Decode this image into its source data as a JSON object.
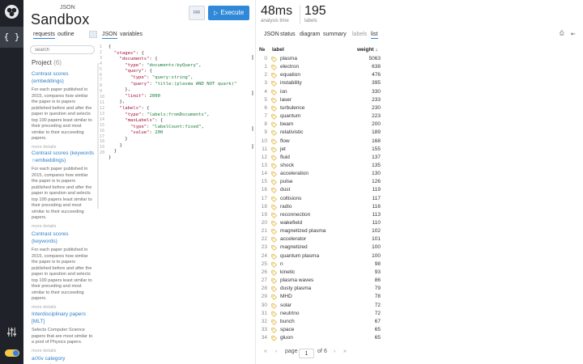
{
  "brand": {
    "superscript": "JSON",
    "name": "Sandbox"
  },
  "toolbar": {
    "execute_label": "Execute",
    "play_glyph": "▷",
    "list_glyph": "≔"
  },
  "stats": {
    "time": {
      "value": "48ms",
      "caption": "analysis time"
    },
    "labels": {
      "value": "195",
      "caption": "labels"
    }
  },
  "left_tabs": {
    "requests": "requests",
    "outline": "outline"
  },
  "editor_tabs": {
    "json": "JSON",
    "variables": "variables"
  },
  "result_tabs": {
    "json": "JSON",
    "status": "status",
    "diagram": "diagram",
    "summary": "summary",
    "labels": "labels",
    "list": "list"
  },
  "rail": {
    "code_label": "{ }"
  },
  "search": {
    "placeholder": "search"
  },
  "project": {
    "title": "Project",
    "count": "(6)",
    "entries": [
      {
        "title": "Contrast scores (embeddings)",
        "desc": "For each paper published in 2015, compares how similar the paper is to papers published before and after the paper in question and selects top 100 papers least similar to their preceding and most similar to their succeeding papers.",
        "more": "more details"
      },
      {
        "title": "Contrast scores (keywords ∩embeddings)",
        "desc": "For each paper published in 2015, compares how similar the paper is to papers published before and after the paper in question and selects top 100 papers least similar to their preceding and most similar to their succeeding papers.",
        "more": "more details"
      },
      {
        "title": "Contrast scores (keywords)",
        "desc": "For each paper published in 2015, compares how similar the paper is to papers published before and after the paper in question and selects top 100 papers least similar to their preceding and most similar to their succeeding papers.",
        "more": "more details"
      },
      {
        "title": "Interdisciplinary papers [MLT]",
        "desc": "Selects Computer Science papers that are most similar to a pool of Physics papers.",
        "more": "more details"
      },
      {
        "title": "arXiv category suggestions",
        "desc": "",
        "more": ""
      }
    ]
  },
  "editor": {
    "line_numbers": [
      "1",
      "2",
      "3",
      "4",
      "5",
      "6",
      "7",
      "8",
      "9",
      "10",
      "11",
      "12",
      "13",
      "14",
      "15",
      "16",
      "17",
      "18",
      "19",
      "20"
    ],
    "lines": [
      "{",
      "  \"stages\": {",
      "    \"documents\": {",
      "      \"type\": \"documents:byQuery\",",
      "      \"query\": {",
      "        \"type\": \"query:string\",",
      "        \"query\": \"title:(plasma AND NOT quark)\"",
      "      },",
      "      \"limit\": 2000",
      "    },",
      "    \"labels\": {",
      "      \"type\": \"labels:fromDocuments\",",
      "      \"maxLabels\": {",
      "        \"type\": \"labelCount:fixed\",",
      "        \"value\": 200",
      "      }",
      "    }",
      "  }",
      "}"
    ]
  },
  "table": {
    "headers": {
      "index": "№",
      "label": "label",
      "weight": "weight ↓"
    },
    "rows": [
      {
        "i": "0",
        "label": "plasma",
        "w": "5063"
      },
      {
        "i": "1",
        "label": "electron",
        "w": "638"
      },
      {
        "i": "2",
        "label": "equation",
        "w": "476"
      },
      {
        "i": "3",
        "label": "instability",
        "w": "395"
      },
      {
        "i": "4",
        "label": "ion",
        "w": "330"
      },
      {
        "i": "5",
        "label": "laser",
        "w": "233"
      },
      {
        "i": "6",
        "label": "turbulence",
        "w": "230"
      },
      {
        "i": "7",
        "label": "quantum",
        "w": "223"
      },
      {
        "i": "8",
        "label": "beam",
        "w": "200"
      },
      {
        "i": "9",
        "label": "relativistic",
        "w": "189"
      },
      {
        "i": "10",
        "label": "flow",
        "w": "168"
      },
      {
        "i": "11",
        "label": "jet",
        "w": "155"
      },
      {
        "i": "12",
        "label": "fluid",
        "w": "137"
      },
      {
        "i": "13",
        "label": "shock",
        "w": "135"
      },
      {
        "i": "14",
        "label": "acceleration",
        "w": "130"
      },
      {
        "i": "15",
        "label": "pulse",
        "w": "126"
      },
      {
        "i": "16",
        "label": "dust",
        "w": "119"
      },
      {
        "i": "17",
        "label": "collisions",
        "w": "117"
      },
      {
        "i": "18",
        "label": "radio",
        "w": "116"
      },
      {
        "i": "19",
        "label": "reconnection",
        "w": "113"
      },
      {
        "i": "20",
        "label": "wakefield",
        "w": "110"
      },
      {
        "i": "21",
        "label": "magnetized plasma",
        "w": "102"
      },
      {
        "i": "22",
        "label": "accelerator",
        "w": "101"
      },
      {
        "i": "23",
        "label": "magnetized",
        "w": "100"
      },
      {
        "i": "24",
        "label": "quantum plasma",
        "w": "100"
      },
      {
        "i": "25",
        "label": "n",
        "w": "98"
      },
      {
        "i": "26",
        "label": "kinetic",
        "w": "93"
      },
      {
        "i": "27",
        "label": "plasma waves",
        "w": "86"
      },
      {
        "i": "28",
        "label": "dusty plasma",
        "w": "79"
      },
      {
        "i": "29",
        "label": "MHD",
        "w": "78"
      },
      {
        "i": "30",
        "label": "solar",
        "w": "72"
      },
      {
        "i": "31",
        "label": "neutrino",
        "w": "72"
      },
      {
        "i": "32",
        "label": "bunch",
        "w": "67"
      },
      {
        "i": "33",
        "label": "space",
        "w": "65"
      },
      {
        "i": "34",
        "label": "gluon",
        "w": "65"
      }
    ]
  },
  "pager": {
    "first": "«",
    "prev": "‹",
    "word": "page",
    "current": "1",
    "of": "of",
    "total": "6",
    "next": "›",
    "last": "»"
  },
  "result_icons": {
    "save": "⎙",
    "collapse": "⇤"
  },
  "colors": {
    "rail": "#1f2228",
    "accent": "#2f89d8",
    "tag": "#e0b53a"
  }
}
